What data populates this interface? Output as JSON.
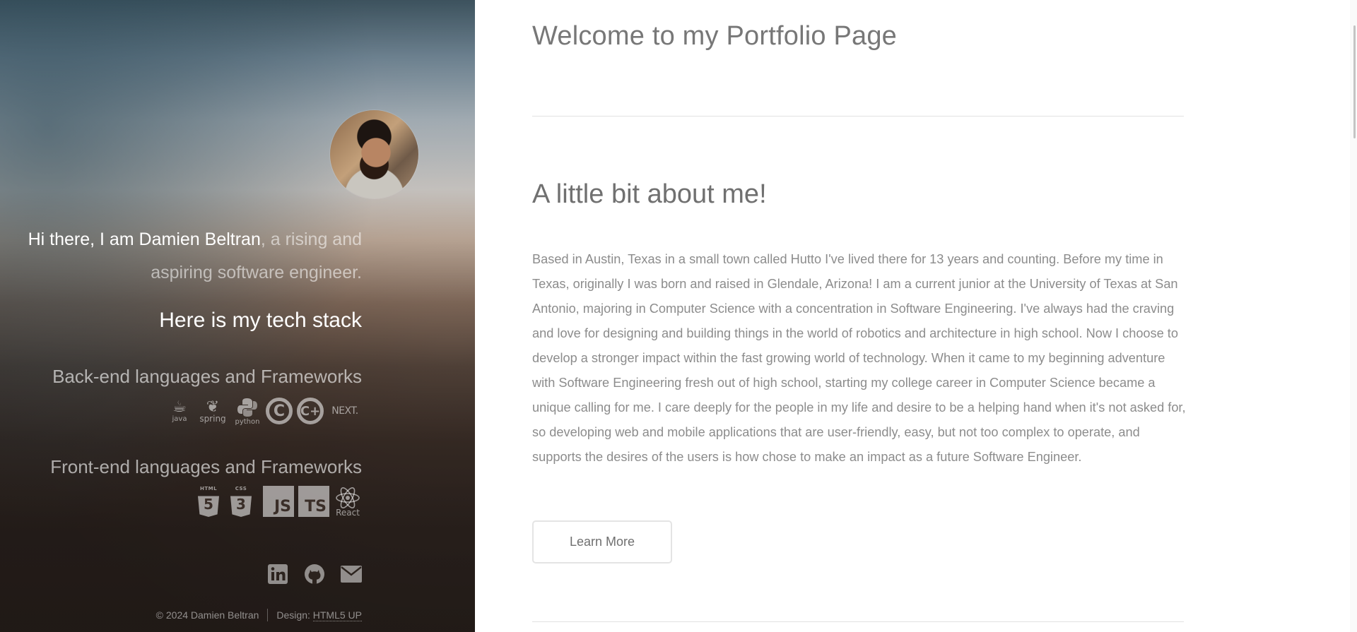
{
  "sidebar": {
    "intro_strong": "Hi there, I am Damien Beltran",
    "intro_rest": ", a rising and aspiring software engineer.",
    "stack_title": "Here is my tech stack",
    "backend_title": "Back-end languages and Frameworks",
    "backend_icons": [
      {
        "icon": "java-icon",
        "caption": "java"
      },
      {
        "icon": "spring-icon",
        "caption": "spring"
      },
      {
        "icon": "python-icon",
        "caption": "python"
      },
      {
        "icon": "c-icon",
        "glyph": "C"
      },
      {
        "icon": "cplusplus-icon",
        "glyph": "C+"
      },
      {
        "icon": "nextjs-icon",
        "caption": "NEXT."
      }
    ],
    "frontend_title": "Front-end languages and Frameworks",
    "frontend_icons": [
      {
        "icon": "html5-icon",
        "label": "HTML",
        "glyph": "5"
      },
      {
        "icon": "css3-icon",
        "label": "CSS",
        "glyph": "3"
      },
      {
        "icon": "javascript-icon",
        "glyph": "JS"
      },
      {
        "icon": "typescript-icon",
        "glyph": "TS"
      },
      {
        "icon": "react-icon",
        "caption": "React"
      }
    ],
    "social": [
      {
        "icon": "linkedin-icon"
      },
      {
        "icon": "github-icon"
      },
      {
        "icon": "email-icon"
      }
    ],
    "footer": {
      "copyright": "© 2024 Damien Beltran",
      "design_label": "Design:",
      "design_link": "HTML5 UP"
    }
  },
  "main": {
    "page_title": "Welcome to my Portfolio Page",
    "section_title": "A little bit about me!",
    "about_text": "Based in Austin, Texas in a small town called Hutto I've lived there for 13 years and counting. Before my time in Texas, originally I was born and raised in Glendale, Arizona! I am a current junior at the University of Texas at San Antonio, majoring in Computer Science with a concentration in Software Engineering. I've always had the craving and love for designing and building things in the world of robotics and architecture in high school. Now I choose to develop a stronger impact within the fast growing world of technology. When it came to my beginning adventure with Software Engineering fresh out of high school, starting my college career in Computer Science became a unique calling for me. I care deeply for the people in my life and desire to be a helping hand when it's not asked for, so developing web and mobile applications that are user-friendly, easy, but not too complex to operate, and supports the desires of the users is how chose to make an impact as a future Software Engineer.",
    "learn_more_label": "Learn More"
  }
}
